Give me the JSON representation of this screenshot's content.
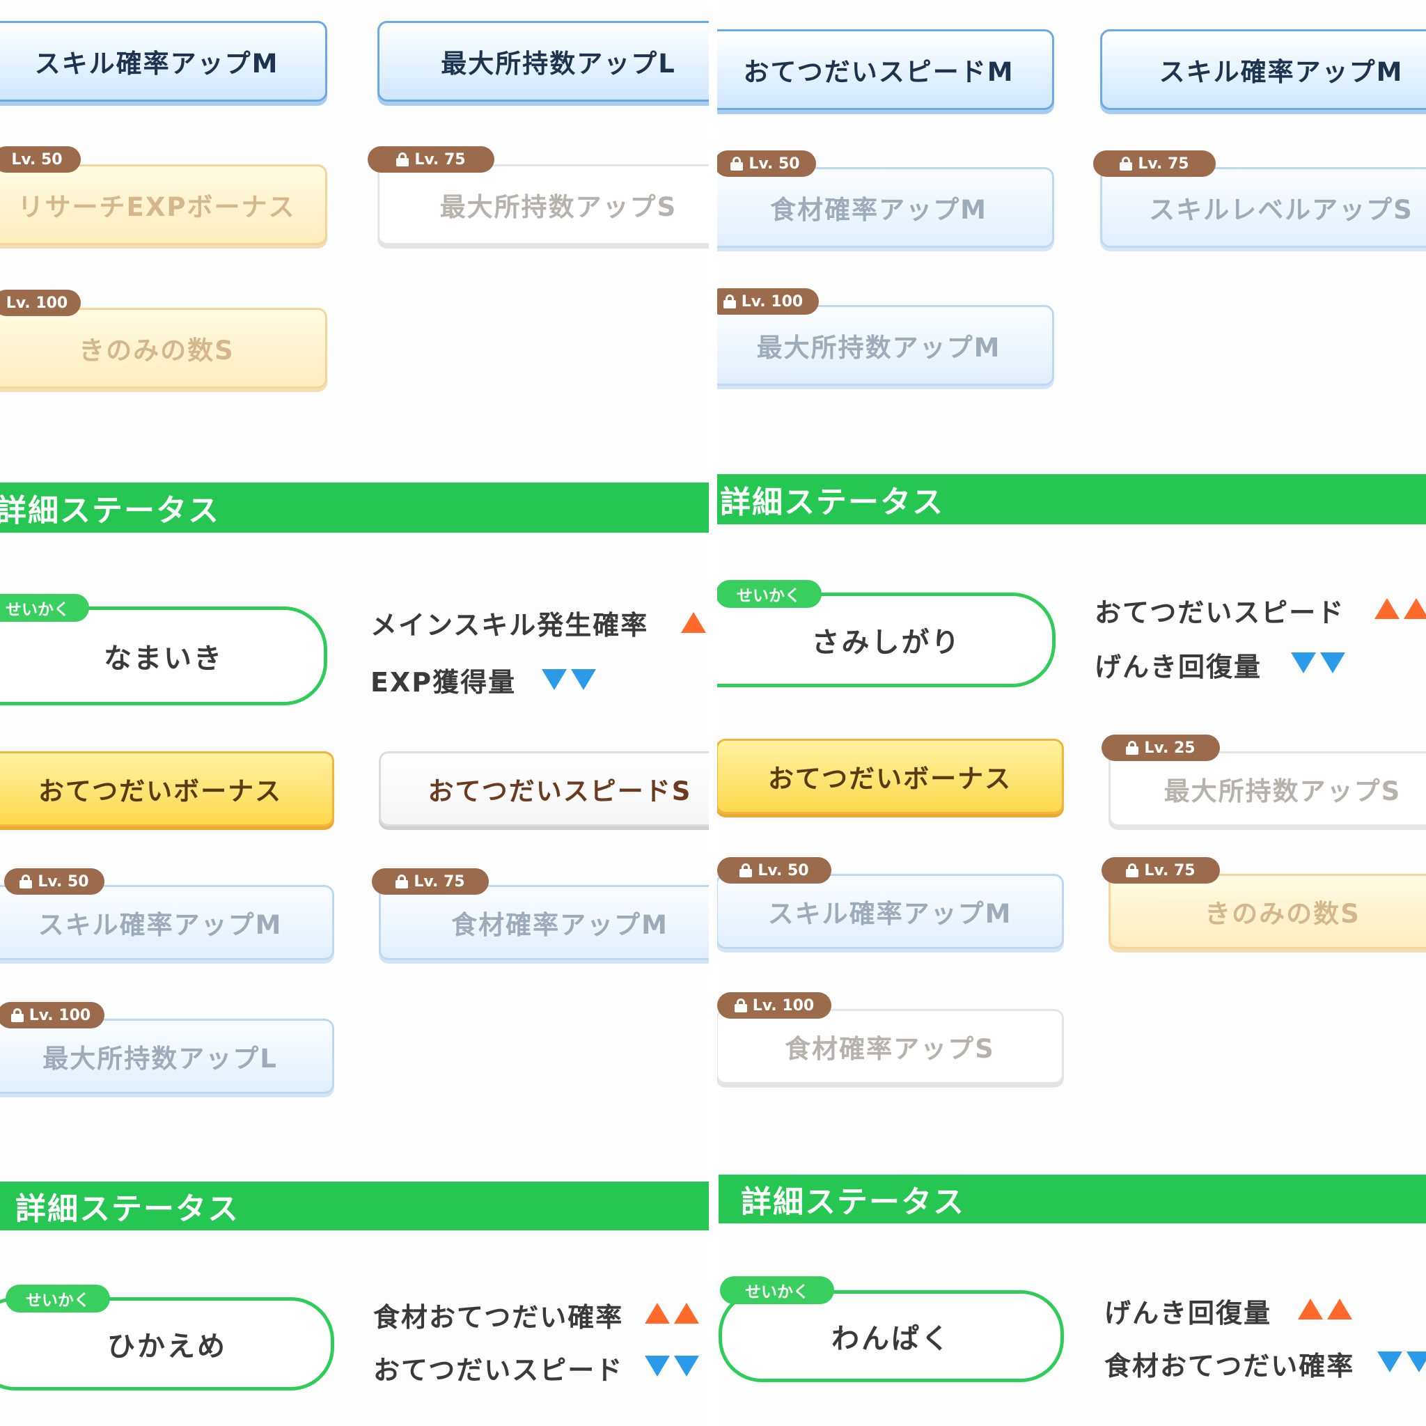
{
  "header_title": "詳細ステータス",
  "nature_tag": "せいかく",
  "colors": {
    "header_green": "#26c652",
    "nature_border": "#2fcc5a",
    "up_arrow": "#ff6a2b",
    "down_arrow": "#2b9ae8",
    "lv_badge": "#9c6b4b"
  },
  "panel_a": {
    "top_left_button": "スキル確率アップM",
    "top_right_button": "最大所持数アップL",
    "sub1": {
      "level": "Lv. 50",
      "label": "リサーチEXPボーナス"
    },
    "sub2": {
      "level": "Lv. 75",
      "label": "最大所持数アップS"
    },
    "sub3": {
      "level": "Lv. 100",
      "label": "きのみの数S"
    }
  },
  "panel_b": {
    "top_left_button": "おてつだいスピードM",
    "top_right_button": "スキル確率アップM",
    "sub1": {
      "level": "Lv. 50",
      "label": "食材確率アップM"
    },
    "sub2": {
      "level": "Lv. 75",
      "label": "スキルレベルアップS"
    },
    "sub3": {
      "level": "Lv. 100",
      "label": "最大所持数アップM"
    }
  },
  "panel_c": {
    "nature": "なまいき",
    "stat_up": "メインスキル発生確率",
    "stat_down": "EXP獲得量",
    "main_skill": "おてつだいボーナス",
    "sub_skill": "おてつだいスピードS",
    "sub1": {
      "level": "Lv. 50",
      "label": "スキル確率アップM"
    },
    "sub2": {
      "level": "Lv. 75",
      "label": "食材確率アップM"
    },
    "sub3": {
      "level": "Lv. 100",
      "label": "最大所持数アップL"
    }
  },
  "panel_d": {
    "nature": "さみしがり",
    "stat_up": "おてつだいスピード",
    "stat_down": "げんき回復量",
    "main_skill": "おてつだいボーナス",
    "sub0": {
      "level": "Lv. 25",
      "label": "最大所持数アップS"
    },
    "sub1": {
      "level": "Lv. 50",
      "label": "スキル確率アップM"
    },
    "sub2": {
      "level": "Lv. 75",
      "label": "きのみの数S"
    },
    "sub3": {
      "level": "Lv. 100",
      "label": "食材確率アップS"
    }
  },
  "panel_e": {
    "nature": "ひかえめ",
    "stat_up": "食材おてつだい確率",
    "stat_down": "おてつだいスピード"
  },
  "panel_f": {
    "nature": "わんぱく",
    "stat_up": "げんき回復量",
    "stat_down": "食材おてつだい確率"
  }
}
